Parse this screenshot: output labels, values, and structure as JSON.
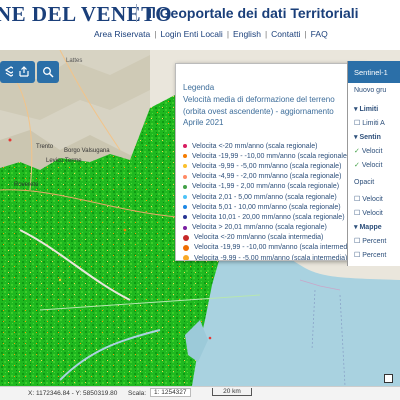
{
  "header": {
    "brand_main": "NE DEL",
    "brand_end": "VENETO",
    "title": "Il Geoportale dei dati Territoriali",
    "nav": [
      "Area Riservata",
      "Login Enti Locali",
      "English",
      "Contatti",
      "FAQ"
    ]
  },
  "toolbar": {
    "buttons": [
      {
        "name": "layers-icon"
      },
      {
        "name": "share-icon"
      },
      {
        "name": "search-icon"
      }
    ]
  },
  "map": {
    "labels": {
      "trento": "Trento",
      "borgo": "Borgo Valsugana",
      "levico": "Levico Terme",
      "rovereto": "Rovereto",
      "lattes": "Lattes"
    }
  },
  "legend": {
    "close": "×",
    "title": "Legenda",
    "desc": "Velocità media di deformazione del terreno (orbita ovest ascendente) - aggiornamento Aprile 2021",
    "items": [
      {
        "label": "Velocita <-20 mm/anno (scala regionale)",
        "color": "#d81b60",
        "size": 4
      },
      {
        "label": "Velocita -19,99 - -10,00 mm/anno (scala regionale)",
        "color": "#f57c00",
        "size": 4
      },
      {
        "label": "Velocita -9,99 - -5,00 mm/anno (scala regionale)",
        "color": "#fbc02d",
        "size": 4
      },
      {
        "label": "Velocita -4,99 - -2,00 mm/anno (scala regionale)",
        "color": "#ff8a65",
        "size": 4
      },
      {
        "label": "Velocita -1,99 - 2,00 mm/anno (scala regionale)",
        "color": "#43a047",
        "size": 4
      },
      {
        "label": "Velocita 2,01 - 5,00 mm/anno (scala regionale)",
        "color": "#4fc3f7",
        "size": 4
      },
      {
        "label": "Velocita 5,01 - 10,00 mm/anno (scala regionale)",
        "color": "#1e88e5",
        "size": 4
      },
      {
        "label": "Velocita 10,01 - 20,00 mm/anno (scala regionale)",
        "color": "#283593",
        "size": 4
      },
      {
        "label": "Velocita > 20,01 mm/anno (scala regionale)",
        "color": "#7b1fa2",
        "size": 4
      },
      {
        "label": "Velocita <-20 mm/anno (scala intermedia)",
        "color": "#c62828",
        "size": 6
      },
      {
        "label": "Velocita -19,99 - -10,00 mm/anno (scala intermedia)",
        "color": "#ef6c00",
        "size": 6
      },
      {
        "label": "Velocita -9,99 - -5,00 mm/anno (scala intermedia)",
        "color": "#f9a825",
        "size": 6
      },
      {
        "label": "Velocita -4,99 - -2,00 mm/anno (scala intermedia)",
        "color": "#ff7043",
        "size": 6
      }
    ]
  },
  "layers": {
    "header": "Sentinel-1",
    "rows": [
      "Nuovo gru",
      "Limiti",
      "Limiti A",
      "Sentin",
      "Velocit",
      "Velocit",
      "Opacit",
      "Velocit",
      "Velocit",
      "Mappe",
      "Percent",
      "Percent"
    ]
  },
  "status": {
    "coords": "X: 1172346.84 - Y: 5850319.80",
    "scale_label": "Scala:",
    "scale_value": "1: 1254327",
    "scalebar": "20 km"
  }
}
